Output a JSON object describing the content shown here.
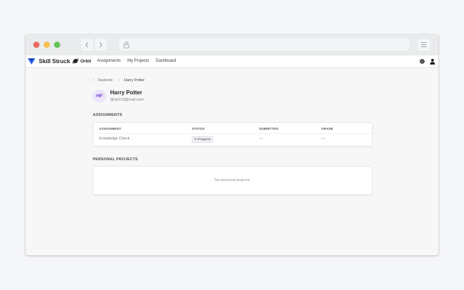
{
  "browser": {
    "back_icon": "chevron-left-icon",
    "forward_icon": "chevron-right-icon",
    "lock_icon": "lock-icon",
    "menu_icon": "hamburger-icon"
  },
  "appbar": {
    "brand": "Skill Struck",
    "orbit": "Orbit",
    "nav": [
      "Assignments",
      "My Projects",
      "Dashboard"
    ]
  },
  "breadcrumb": {
    "parent": "Students",
    "separator": "/",
    "current": "Harry Potter"
  },
  "student": {
    "initials": "HP",
    "name": "Harry Potter",
    "email": "@hp123@mail.com"
  },
  "assignments": {
    "title": "ASSIGNMENTS",
    "columns": [
      "ASSIGNMENT",
      "STATUS",
      "SUBMITTED",
      "GRADE"
    ],
    "rows": [
      {
        "assignment": "Knowledge Check",
        "status": "In Progress",
        "submitted": "—",
        "grade": "—"
      }
    ]
  },
  "projects": {
    "title": "PERSONAL PROJECTS",
    "empty": "No personal projects."
  },
  "colors": {
    "brand_blue": "#2563eb",
    "avatar_bg": "#ece4f8",
    "avatar_text": "#6c3cc9"
  }
}
